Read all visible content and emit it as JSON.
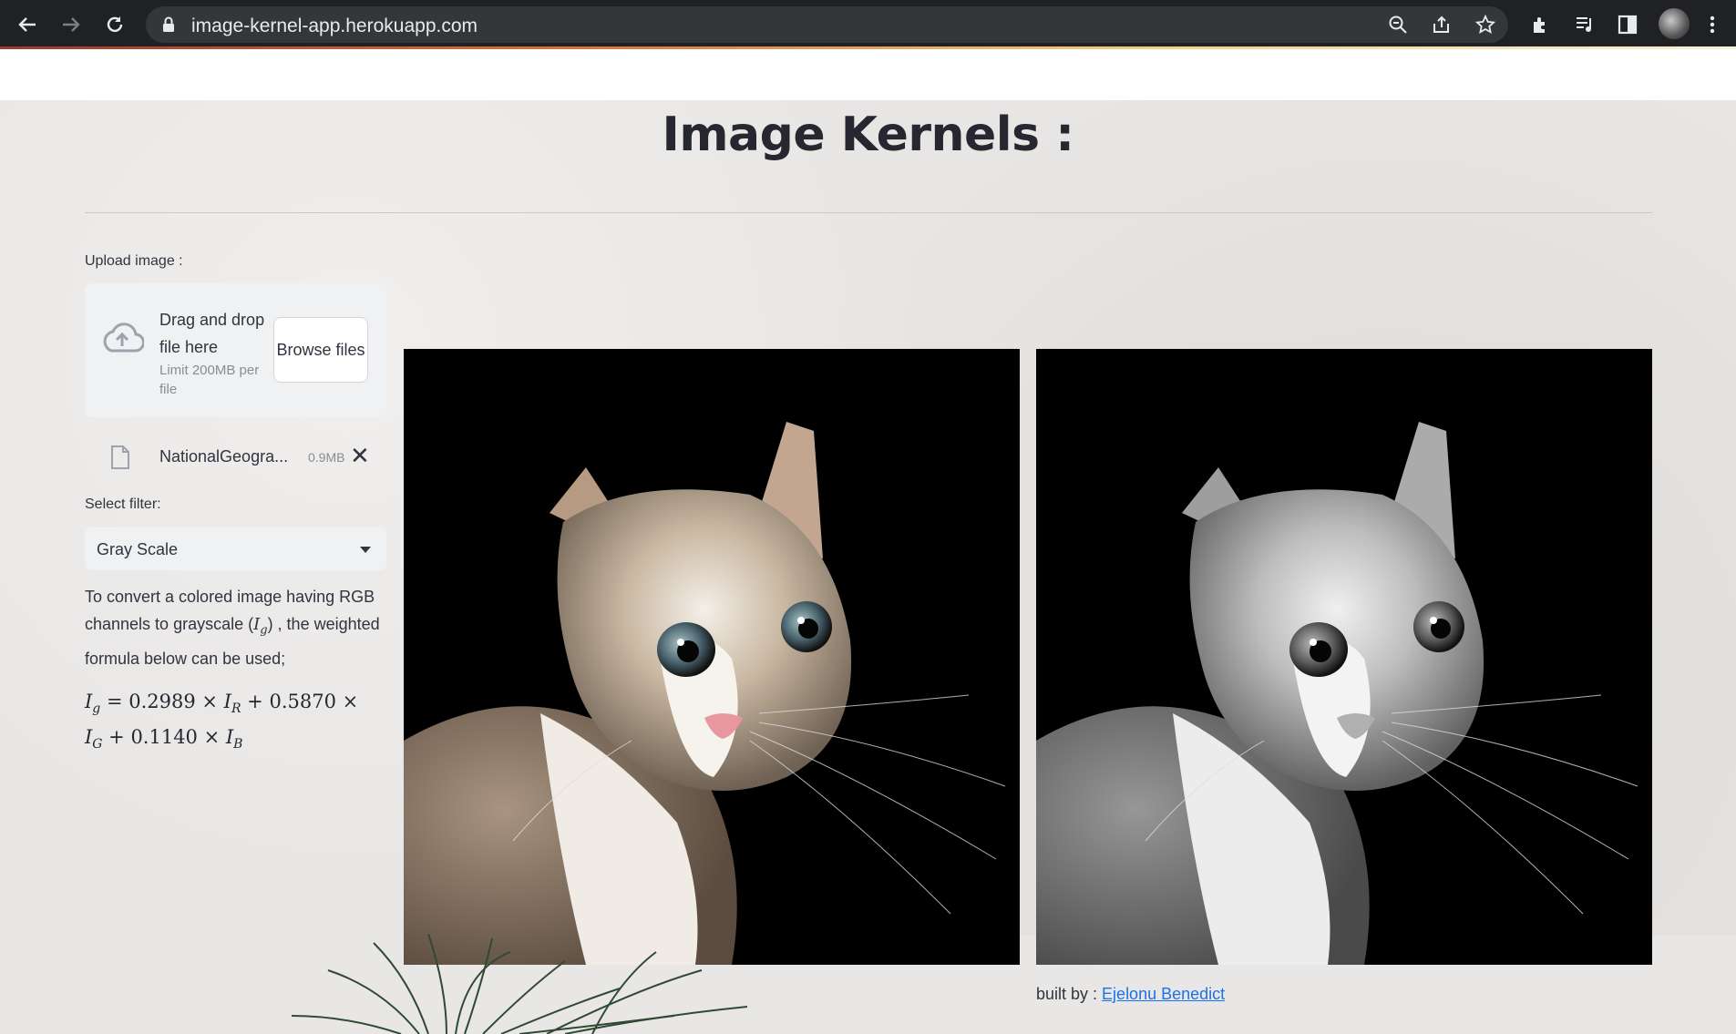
{
  "browser": {
    "url": "image-kernel-app.herokuapp.com",
    "icons": [
      "back-arrow-icon",
      "forward-arrow-icon",
      "reload-icon",
      "lock-icon",
      "zoom-icon",
      "share-icon",
      "star-icon",
      "extensions-icon",
      "media-icon",
      "side-panel-icon",
      "profile-avatar",
      "menu-icon"
    ]
  },
  "app": {
    "title": "Image Kernels :",
    "upload": {
      "label": "Upload image :",
      "drag_text": "Drag and drop file here",
      "limit_text": "Limit 200MB per file",
      "browse_label": "Browse files"
    },
    "file": {
      "name": "NationalGeogra...",
      "size": "0.9MB"
    },
    "filter": {
      "label": "Select filter:",
      "selected": "Gray Scale"
    },
    "description": {
      "part1": "To convert a colored image having RGB channels to grayscale (",
      "symbol": "I",
      "sub": "g",
      "part2": ") , the weighted formula below can be used;"
    },
    "formula": {
      "line1_coef1": "0.2989",
      "line1_coef2": "0.5870",
      "line2_coef3": "0.1140"
    },
    "images": {
      "original_alt": "cat color photo",
      "processed_alt": "cat grayscale photo"
    },
    "footer": {
      "prefix": "built by : ",
      "author": "Ejelonu Benedict"
    },
    "colors": {
      "text": "#31333f",
      "link": "#1a73e8",
      "widget_bg": "#f0f1f3"
    }
  }
}
